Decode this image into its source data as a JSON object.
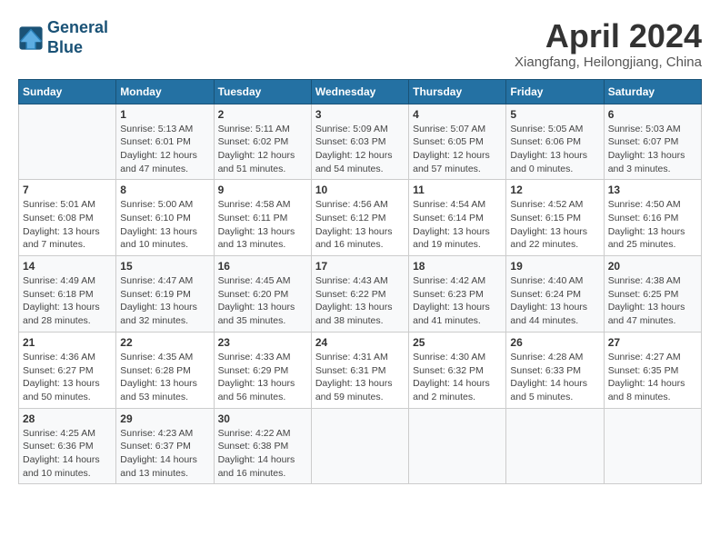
{
  "header": {
    "logo_line1": "General",
    "logo_line2": "Blue",
    "month_year": "April 2024",
    "location": "Xiangfang, Heilongjiang, China"
  },
  "weekdays": [
    "Sunday",
    "Monday",
    "Tuesday",
    "Wednesday",
    "Thursday",
    "Friday",
    "Saturday"
  ],
  "weeks": [
    [
      {
        "day": "",
        "detail": ""
      },
      {
        "day": "1",
        "detail": "Sunrise: 5:13 AM\nSunset: 6:01 PM\nDaylight: 12 hours\nand 47 minutes."
      },
      {
        "day": "2",
        "detail": "Sunrise: 5:11 AM\nSunset: 6:02 PM\nDaylight: 12 hours\nand 51 minutes."
      },
      {
        "day": "3",
        "detail": "Sunrise: 5:09 AM\nSunset: 6:03 PM\nDaylight: 12 hours\nand 54 minutes."
      },
      {
        "day": "4",
        "detail": "Sunrise: 5:07 AM\nSunset: 6:05 PM\nDaylight: 12 hours\nand 57 minutes."
      },
      {
        "day": "5",
        "detail": "Sunrise: 5:05 AM\nSunset: 6:06 PM\nDaylight: 13 hours\nand 0 minutes."
      },
      {
        "day": "6",
        "detail": "Sunrise: 5:03 AM\nSunset: 6:07 PM\nDaylight: 13 hours\nand 3 minutes."
      }
    ],
    [
      {
        "day": "7",
        "detail": "Sunrise: 5:01 AM\nSunset: 6:08 PM\nDaylight: 13 hours\nand 7 minutes."
      },
      {
        "day": "8",
        "detail": "Sunrise: 5:00 AM\nSunset: 6:10 PM\nDaylight: 13 hours\nand 10 minutes."
      },
      {
        "day": "9",
        "detail": "Sunrise: 4:58 AM\nSunset: 6:11 PM\nDaylight: 13 hours\nand 13 minutes."
      },
      {
        "day": "10",
        "detail": "Sunrise: 4:56 AM\nSunset: 6:12 PM\nDaylight: 13 hours\nand 16 minutes."
      },
      {
        "day": "11",
        "detail": "Sunrise: 4:54 AM\nSunset: 6:14 PM\nDaylight: 13 hours\nand 19 minutes."
      },
      {
        "day": "12",
        "detail": "Sunrise: 4:52 AM\nSunset: 6:15 PM\nDaylight: 13 hours\nand 22 minutes."
      },
      {
        "day": "13",
        "detail": "Sunrise: 4:50 AM\nSunset: 6:16 PM\nDaylight: 13 hours\nand 25 minutes."
      }
    ],
    [
      {
        "day": "14",
        "detail": "Sunrise: 4:49 AM\nSunset: 6:18 PM\nDaylight: 13 hours\nand 28 minutes."
      },
      {
        "day": "15",
        "detail": "Sunrise: 4:47 AM\nSunset: 6:19 PM\nDaylight: 13 hours\nand 32 minutes."
      },
      {
        "day": "16",
        "detail": "Sunrise: 4:45 AM\nSunset: 6:20 PM\nDaylight: 13 hours\nand 35 minutes."
      },
      {
        "day": "17",
        "detail": "Sunrise: 4:43 AM\nSunset: 6:22 PM\nDaylight: 13 hours\nand 38 minutes."
      },
      {
        "day": "18",
        "detail": "Sunrise: 4:42 AM\nSunset: 6:23 PM\nDaylight: 13 hours\nand 41 minutes."
      },
      {
        "day": "19",
        "detail": "Sunrise: 4:40 AM\nSunset: 6:24 PM\nDaylight: 13 hours\nand 44 minutes."
      },
      {
        "day": "20",
        "detail": "Sunrise: 4:38 AM\nSunset: 6:25 PM\nDaylight: 13 hours\nand 47 minutes."
      }
    ],
    [
      {
        "day": "21",
        "detail": "Sunrise: 4:36 AM\nSunset: 6:27 PM\nDaylight: 13 hours\nand 50 minutes."
      },
      {
        "day": "22",
        "detail": "Sunrise: 4:35 AM\nSunset: 6:28 PM\nDaylight: 13 hours\nand 53 minutes."
      },
      {
        "day": "23",
        "detail": "Sunrise: 4:33 AM\nSunset: 6:29 PM\nDaylight: 13 hours\nand 56 minutes."
      },
      {
        "day": "24",
        "detail": "Sunrise: 4:31 AM\nSunset: 6:31 PM\nDaylight: 13 hours\nand 59 minutes."
      },
      {
        "day": "25",
        "detail": "Sunrise: 4:30 AM\nSunset: 6:32 PM\nDaylight: 14 hours\nand 2 minutes."
      },
      {
        "day": "26",
        "detail": "Sunrise: 4:28 AM\nSunset: 6:33 PM\nDaylight: 14 hours\nand 5 minutes."
      },
      {
        "day": "27",
        "detail": "Sunrise: 4:27 AM\nSunset: 6:35 PM\nDaylight: 14 hours\nand 8 minutes."
      }
    ],
    [
      {
        "day": "28",
        "detail": "Sunrise: 4:25 AM\nSunset: 6:36 PM\nDaylight: 14 hours\nand 10 minutes."
      },
      {
        "day": "29",
        "detail": "Sunrise: 4:23 AM\nSunset: 6:37 PM\nDaylight: 14 hours\nand 13 minutes."
      },
      {
        "day": "30",
        "detail": "Sunrise: 4:22 AM\nSunset: 6:38 PM\nDaylight: 14 hours\nand 16 minutes."
      },
      {
        "day": "",
        "detail": ""
      },
      {
        "day": "",
        "detail": ""
      },
      {
        "day": "",
        "detail": ""
      },
      {
        "day": "",
        "detail": ""
      }
    ]
  ]
}
